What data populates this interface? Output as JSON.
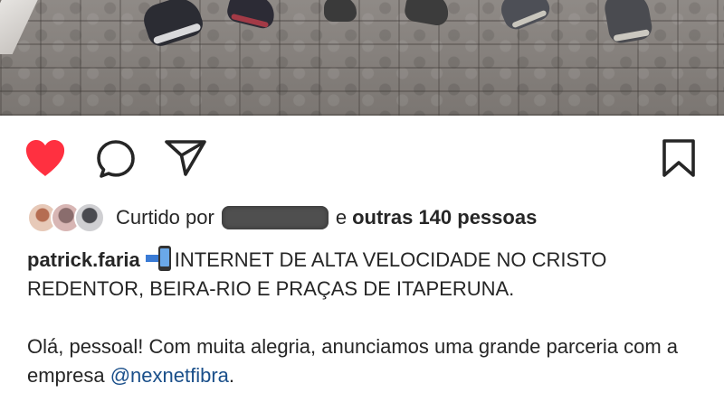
{
  "post": {
    "photo": {
      "description_icon": "post-photo"
    },
    "actions": {
      "like_icon": "heart-filled-icon",
      "comment_icon": "comment-bubble-icon",
      "share_icon": "paper-plane-icon",
      "save_icon": "bookmark-icon",
      "like_color": "#ff3040"
    },
    "likes": {
      "prefix": "Curtido por",
      "connector": "e",
      "others": "outras 140 pessoas"
    },
    "caption": {
      "username": "patrick.faria",
      "line1": "INTERNET DE ALTA VELOCIDADE NO CRISTO REDENTOR, BEIRA-RIO E PRAÇAS DE ITAPERUNA.",
      "body_text": "Olá, pessoal! Com muita alegria, anunciamos uma grande parceria com a empresa ",
      "mention": "@nexnetfibra",
      "body_end": "."
    }
  }
}
